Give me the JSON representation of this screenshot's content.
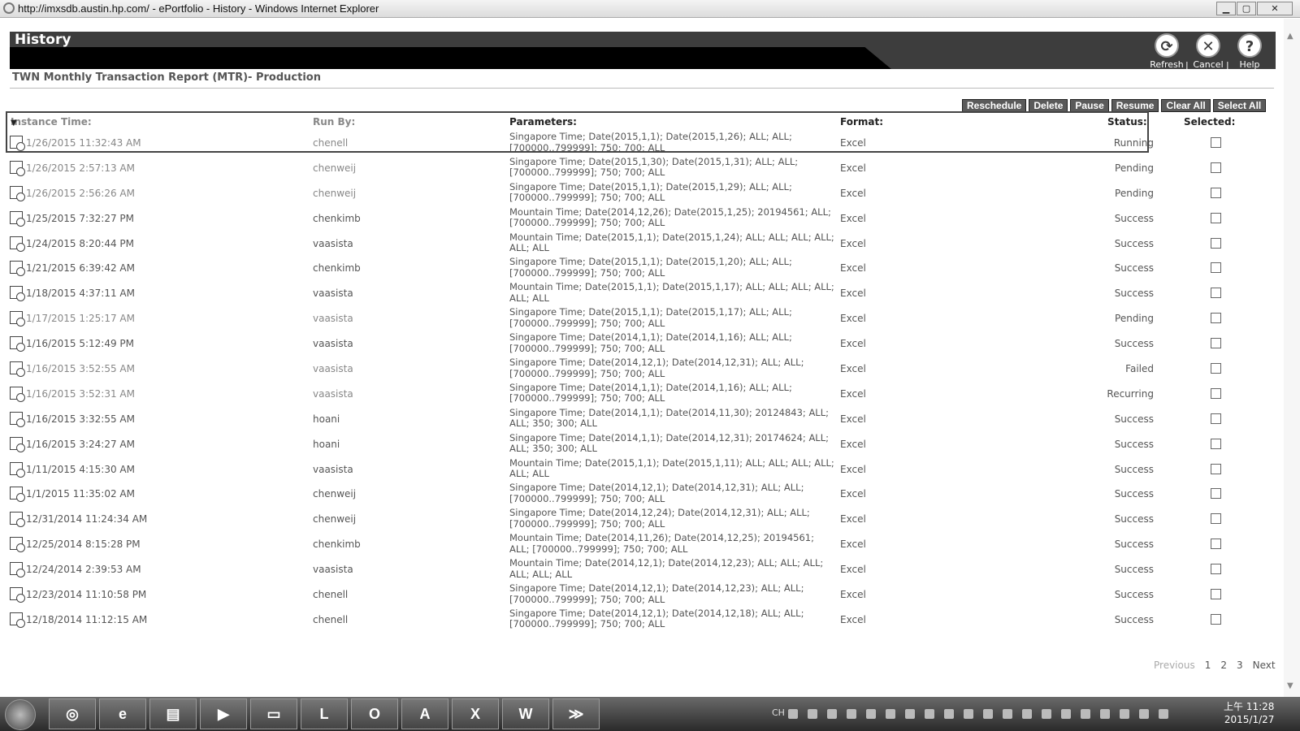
{
  "window": {
    "title": "http://imxsdb.austin.hp.com/ - ePortfolio - History - Windows Internet Explorer",
    "min": "▁",
    "max": "▢",
    "close": "✕"
  },
  "header": {
    "title": "History",
    "actions": [
      {
        "label": "Refresh",
        "glyph": "⟳",
        "icon": "refresh-icon"
      },
      {
        "label": "Cancel",
        "glyph": "✕",
        "icon": "cancel-icon"
      },
      {
        "label": "Help",
        "glyph": "?",
        "icon": "help-icon"
      }
    ],
    "separator": "|"
  },
  "report_title": "TWN Monthly Transaction Report (MTR)- Production",
  "action_buttons": [
    "Reschedule",
    "Delete",
    "Pause",
    "Resume",
    "Clear All",
    "Select All"
  ],
  "columns": {
    "sort_indicator": "▼",
    "instance_time": "Instance Time:",
    "run_by": "Run By:",
    "parameters": "Parameters:",
    "format": "Format:",
    "status": "Status:",
    "selected": "Selected:"
  },
  "rows": [
    {
      "time": "1/26/2015 11:32:43 AM",
      "run_by": "chenell",
      "params": "Singapore Time; Date(2015,1,1); Date(2015,1,26); ALL; ALL; [700000..799999]; 750; 700; ALL",
      "format": "Excel",
      "status": "Running"
    },
    {
      "time": "1/26/2015 2:57:13 AM",
      "run_by": "chenweij",
      "params": "Singapore Time; Date(2015,1,30); Date(2015,1,31); ALL; ALL; [700000..799999]; 750; 700; ALL",
      "format": "Excel",
      "status": "Pending"
    },
    {
      "time": "1/26/2015 2:56:26 AM",
      "run_by": "chenweij",
      "params": "Singapore Time; Date(2015,1,1); Date(2015,1,29); ALL; ALL; [700000..799999]; 750; 700; ALL",
      "format": "Excel",
      "status": "Pending"
    },
    {
      "time": "1/25/2015 7:32:27 PM",
      "run_by": "chenkimb",
      "params": "Mountain Time; Date(2014,12,26); Date(2015,1,25); 20194561; ALL; [700000..799999]; 750; 700; ALL",
      "format": "Excel",
      "status": "Success"
    },
    {
      "time": "1/24/2015 8:20:44 PM",
      "run_by": "vaasista",
      "params": "Mountain Time; Date(2015,1,1); Date(2015,1,24); ALL; ALL; ALL; ALL; ALL; ALL",
      "format": "Excel",
      "status": "Success"
    },
    {
      "time": "1/21/2015 6:39:42 AM",
      "run_by": "chenkimb",
      "params": "Singapore Time; Date(2015,1,1); Date(2015,1,20); ALL; ALL; [700000..799999]; 750; 700; ALL",
      "format": "Excel",
      "status": "Success"
    },
    {
      "time": "1/18/2015 4:37:11 AM",
      "run_by": "vaasista",
      "params": "Mountain Time; Date(2015,1,1); Date(2015,1,17); ALL; ALL; ALL; ALL; ALL; ALL",
      "format": "Excel",
      "status": "Success"
    },
    {
      "time": "1/17/2015 1:25:17 AM",
      "run_by": "vaasista",
      "params": "Singapore Time; Date(2015,1,1); Date(2015,1,17); ALL; ALL; [700000..799999]; 750; 700; ALL",
      "format": "Excel",
      "status": "Pending"
    },
    {
      "time": "1/16/2015 5:12:49 PM",
      "run_by": "vaasista",
      "params": "Singapore Time; Date(2014,1,1); Date(2014,1,16); ALL; ALL; [700000..799999]; 750; 700; ALL",
      "format": "Excel",
      "status": "Success"
    },
    {
      "time": "1/16/2015 3:52:55 AM",
      "run_by": "vaasista",
      "params": "Singapore Time; Date(2014,12,1); Date(2014,12,31); ALL; ALL; [700000..799999]; 750; 700; ALL",
      "format": "Excel",
      "status": "Failed"
    },
    {
      "time": "1/16/2015 3:52:31 AM",
      "run_by": "vaasista",
      "params": "Singapore Time; Date(2014,1,1); Date(2014,1,16); ALL; ALL; [700000..799999]; 750; 700; ALL",
      "format": "Excel",
      "status": "Recurring"
    },
    {
      "time": "1/16/2015 3:32:55 AM",
      "run_by": "hoani",
      "params": "Singapore Time; Date(2014,1,1); Date(2014,11,30); 20124843; ALL; ALL; 350; 300; ALL",
      "format": "Excel",
      "status": "Success"
    },
    {
      "time": "1/16/2015 3:24:27 AM",
      "run_by": "hoani",
      "params": "Singapore Time; Date(2014,1,1); Date(2014,12,31); 20174624; ALL; ALL; 350; 300; ALL",
      "format": "Excel",
      "status": "Success"
    },
    {
      "time": "1/11/2015 4:15:30 AM",
      "run_by": "vaasista",
      "params": "Mountain Time; Date(2015,1,1); Date(2015,1,11); ALL; ALL; ALL; ALL; ALL; ALL",
      "format": "Excel",
      "status": "Success"
    },
    {
      "time": "1/1/2015 11:35:02 AM",
      "run_by": "chenweij",
      "params": "Singapore Time; Date(2014,12,1); Date(2014,12,31); ALL; ALL; [700000..799999]; 750; 700; ALL",
      "format": "Excel",
      "status": "Success"
    },
    {
      "time": "12/31/2014 11:24:34 AM",
      "run_by": "chenweij",
      "params": "Singapore Time; Date(2014,12,24); Date(2014,12,31); ALL; ALL; [700000..799999]; 750; 700; ALL",
      "format": "Excel",
      "status": "Success"
    },
    {
      "time": "12/25/2014 8:15:28 PM",
      "run_by": "chenkimb",
      "params": "Mountain Time; Date(2014,11,26); Date(2014,12,25); 20194561; ALL; [700000..799999]; 750; 700; ALL",
      "format": "Excel",
      "status": "Success"
    },
    {
      "time": "12/24/2014 2:39:53 AM",
      "run_by": "vaasista",
      "params": "Mountain Time; Date(2014,12,1); Date(2014,12,23); ALL; ALL; ALL; ALL; ALL; ALL",
      "format": "Excel",
      "status": "Success"
    },
    {
      "time": "12/23/2014 11:10:58 PM",
      "run_by": "chenell",
      "params": "Singapore Time; Date(2014,12,1); Date(2014,12,23); ALL; ALL; [700000..799999]; 750; 700; ALL",
      "format": "Excel",
      "status": "Success"
    },
    {
      "time": "12/18/2014 11:12:15 AM",
      "run_by": "chenell",
      "params": "Singapore Time; Date(2014,12,1); Date(2014,12,18); ALL; ALL; [700000..799999]; 750; 700; ALL",
      "format": "Excel",
      "status": "Success"
    }
  ],
  "pagination": {
    "previous": "Previous",
    "pages": [
      "1",
      "2",
      "3"
    ],
    "next": "Next"
  },
  "scroll": {
    "up": "▲",
    "down": "▼"
  },
  "taskbar": {
    "apps": [
      {
        "name": "chrome",
        "glyph": "◎"
      },
      {
        "name": "ie",
        "glyph": "e"
      },
      {
        "name": "file-explorer",
        "glyph": "▤"
      },
      {
        "name": "media-player",
        "glyph": "▶"
      },
      {
        "name": "notes",
        "glyph": "▭"
      },
      {
        "name": "lync",
        "glyph": "L"
      },
      {
        "name": "outlook",
        "glyph": "O"
      },
      {
        "name": "acrobat",
        "glyph": "A"
      },
      {
        "name": "excel",
        "glyph": "X"
      },
      {
        "name": "word",
        "glyph": "W"
      },
      {
        "name": "powershell",
        "glyph": "≫"
      }
    ],
    "lang": "CH",
    "clock_time": "上午 11:28",
    "clock_date": "2015/1/27"
  }
}
